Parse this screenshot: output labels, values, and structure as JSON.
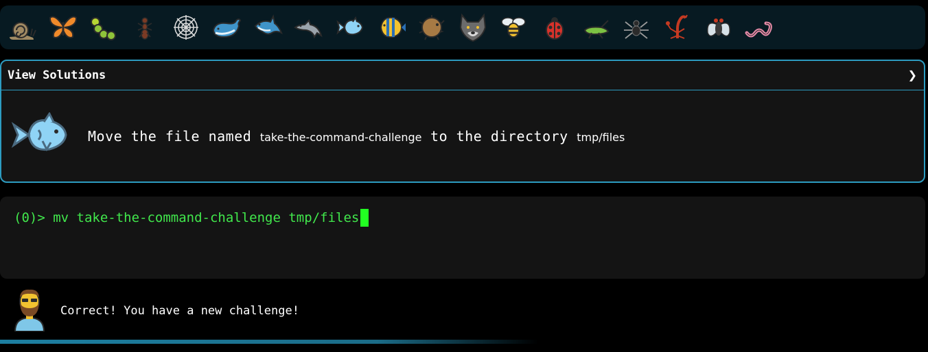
{
  "levels": [
    {
      "icon": "snail-icon"
    },
    {
      "icon": "butterfly-icon"
    },
    {
      "icon": "caterpillar-icon"
    },
    {
      "icon": "ant-icon"
    },
    {
      "icon": "spider-web-icon"
    },
    {
      "icon": "whale-icon"
    },
    {
      "icon": "shark-icon"
    },
    {
      "icon": "dolphin-icon"
    },
    {
      "icon": "fish-icon"
    },
    {
      "icon": "tropical-fish-icon"
    },
    {
      "icon": "blowfish-icon"
    },
    {
      "icon": "wolf-icon"
    },
    {
      "icon": "bee-icon"
    },
    {
      "icon": "ladybug-icon"
    },
    {
      "icon": "cricket-icon"
    },
    {
      "icon": "spider-icon"
    },
    {
      "icon": "scorpion-icon"
    },
    {
      "icon": "fly-icon"
    },
    {
      "icon": "worm-icon"
    }
  ],
  "panel": {
    "title": "View Solutions",
    "chevron": "❯",
    "challenge_icon": "fish-icon",
    "text_1": "Move the file named",
    "code_1": "take-the-command-challenge",
    "text_2": "to the directory",
    "code_2": "tmp/files"
  },
  "terminal": {
    "prompt": "(0)> ",
    "command": "mv take-the-command-challenge tmp/files"
  },
  "feedback": {
    "avatar": "bearded-man-icon",
    "message": "Correct! You have a new challenge!"
  },
  "progress": {
    "fraction": 0.58
  },
  "colors": {
    "accent": "#2d9cc1",
    "terminal_text": "#41e84c",
    "cursor": "#22ff22"
  }
}
